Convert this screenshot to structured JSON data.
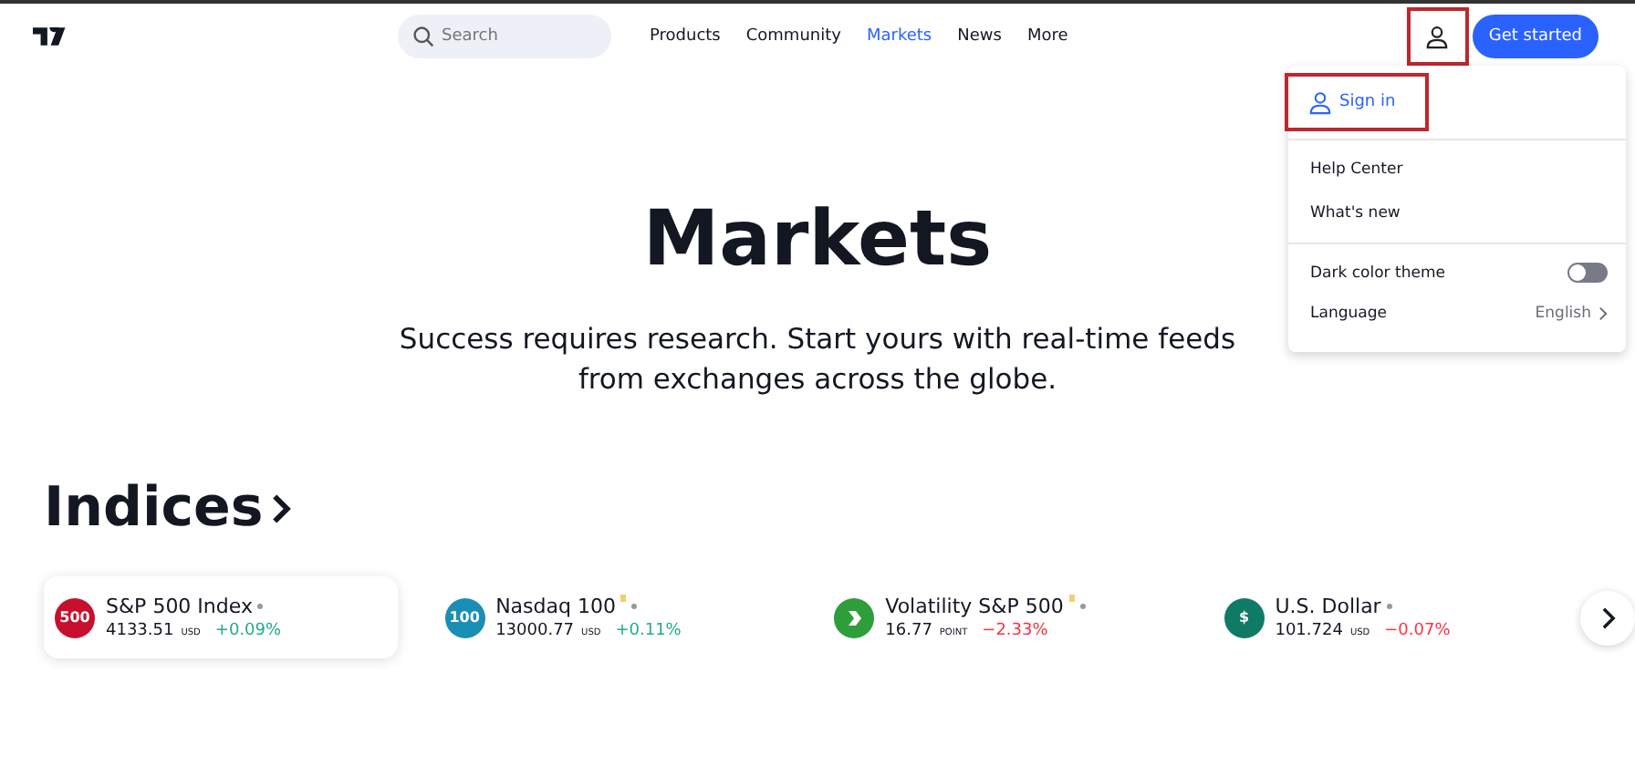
{
  "nav": {
    "search": {
      "placeholder": "Search"
    },
    "links": [
      {
        "label": "Products",
        "selected": false
      },
      {
        "label": "Community",
        "selected": false
      },
      {
        "label": "Markets",
        "selected": true
      },
      {
        "label": "News",
        "selected": false
      },
      {
        "label": "More",
        "selected": false
      }
    ],
    "user_button": {
      "highlighted": true
    },
    "cta": "Get started"
  },
  "menu": {
    "sign_in": {
      "label": "Sign in",
      "highlighted": true
    },
    "links": [
      "Help Center",
      "What's new"
    ],
    "dark_theme": {
      "label": "Dark color theme",
      "on": false
    },
    "language": {
      "label": "Language",
      "value": "English"
    }
  },
  "hero": {
    "title": "Markets",
    "subtitle": "Success requires research. Start yours with real-time feeds from exchanges across the globe."
  },
  "indices": {
    "heading": "Indices",
    "items": [
      {
        "badge": "500",
        "color": "#c8102e",
        "name": "S&P 500 Index",
        "delayed": false,
        "value": "4133.51",
        "unit": "USD",
        "change": {
          "text": "+0.09%",
          "color": "#22ab94"
        },
        "selected": true
      },
      {
        "badge": "100",
        "color": "#1a8fb5",
        "name": "Nasdaq 100",
        "delayed": true,
        "value": "13000.77",
        "unit": "USD",
        "change": {
          "text": "+0.11%",
          "color": "#22ab94"
        },
        "selected": false
      },
      {
        "color": "#2e9e3a",
        "name": "Volatility S&P 500",
        "delayed": true,
        "value": "16.77",
        "unit": "POINT",
        "change": {
          "text": "−2.33%",
          "color": "#f23645"
        },
        "selected": false
      },
      {
        "badge": "$",
        "color": "#0f7a66",
        "name": "U.S. Dollar",
        "delayed": false,
        "value": "101.724",
        "unit": "USD",
        "change": {
          "text": "−0.07%",
          "color": "#f23645"
        },
        "selected": false
      }
    ]
  }
}
